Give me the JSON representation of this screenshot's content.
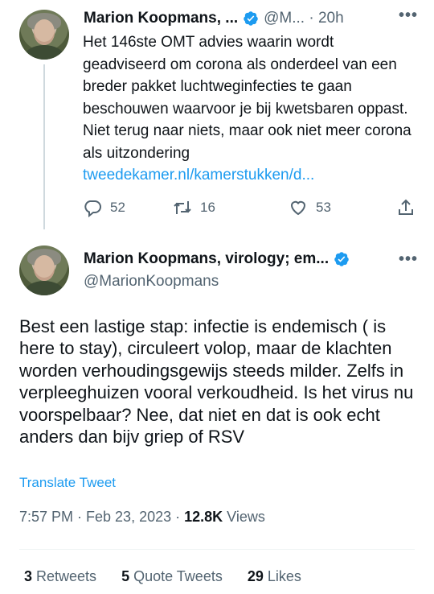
{
  "reply_tweet": {
    "author_name": "Marion Koopmans, ...",
    "handle_time": "@M... · 20h",
    "text": "Het 146ste OMT advies waarin wordt geadviseerd om corona als onderdeel van een breder pakket luchtweginfecties te gaan beschouwen waarvoor je bij kwetsbaren oppast. Niet terug naar niets, maar ook niet meer corona als uitzondering",
    "link": "tweedekamer.nl/kamerstukken/d...",
    "replies": "52",
    "retweets": "16",
    "likes": "53"
  },
  "main_tweet": {
    "author_name": "Marion Koopmans, virology; em...",
    "handle": "@MarionKoopmans",
    "text": "Best een lastige stap: infectie is endemisch ( is here to stay), circuleert volop, maar de klachten worden verhoudingsgewijs steeds milder. Zelfs in verpleeghuizen vooral verkoudheid. Is het virus nu voorspelbaar? Nee, dat niet en dat is ook echt anders dan bijv griep of RSV",
    "translate": "Translate Tweet",
    "timestamp": "7:57 PM · Feb 23, 2023 · ",
    "views_count": "12.8K",
    "views_label": " Views",
    "retweets_count": "3",
    "retweets_label": " Retweets",
    "quotes_count": "5",
    "quotes_label": " Quote Tweets",
    "likes_count": "29",
    "likes_label": " Likes"
  },
  "colors": {
    "accent": "#1d9bf0",
    "secondary_text": "#536471",
    "verified": "#1d9bf0"
  },
  "icons": [
    "reply-icon",
    "retweet-icon",
    "like-icon",
    "share-icon",
    "verified-badge-icon",
    "more-icon"
  ]
}
